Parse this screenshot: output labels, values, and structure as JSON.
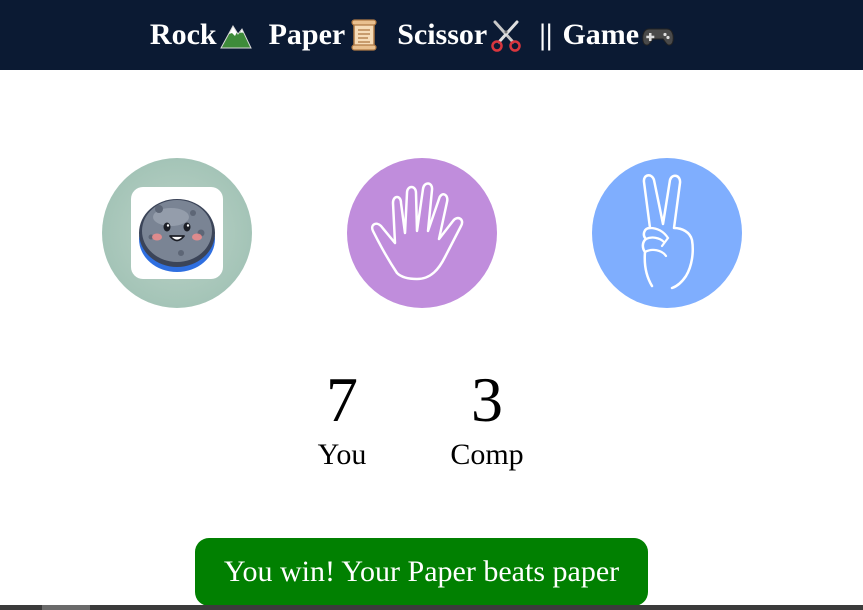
{
  "header": {
    "rock": "Rock",
    "paper": "Paper",
    "scissor": "Scissor",
    "separator": "||",
    "game": "Game",
    "icons": [
      "mountain-icon",
      "scroll-icon",
      "scissors-icon",
      "gamepad-icon"
    ]
  },
  "choices": [
    {
      "id": "rock",
      "icon": "rock-face-icon",
      "color": "#a4c4b7"
    },
    {
      "id": "paper",
      "icon": "open-hand-icon",
      "color": "#c08ddc"
    },
    {
      "id": "scissors",
      "icon": "victory-hand-icon",
      "color": "#7faefe"
    }
  ],
  "scores": {
    "you": {
      "value": "7",
      "label": "You"
    },
    "comp": {
      "value": "3",
      "label": "Comp"
    }
  },
  "message": {
    "text": "You win! Your Paper beats paper",
    "color": "#018001"
  },
  "colors": {
    "header_bg": "#0b1a33",
    "header_text": "#ffffff"
  }
}
